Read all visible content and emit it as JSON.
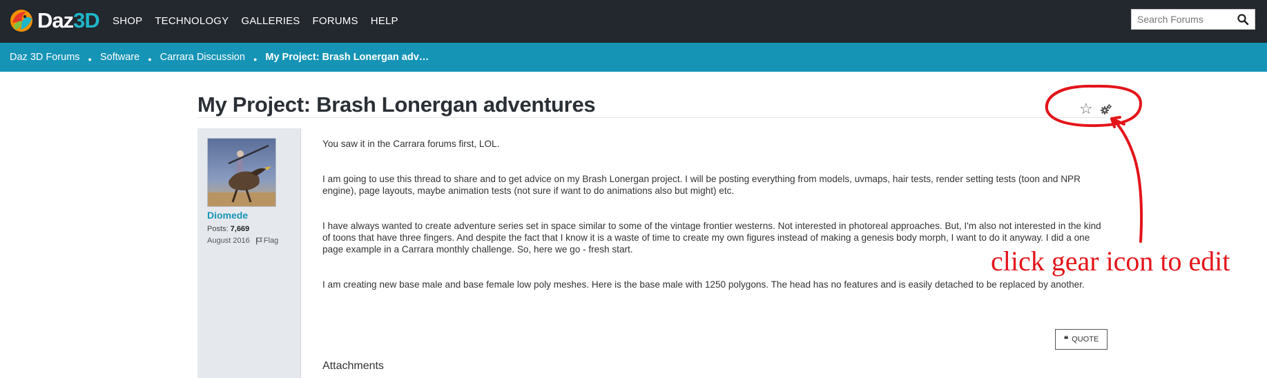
{
  "brand": {
    "name_part1": "Daz",
    "name_part2": "3D"
  },
  "nav": {
    "items": [
      {
        "label": "SHOP"
      },
      {
        "label": "TECHNOLOGY"
      },
      {
        "label": "GALLERIES"
      },
      {
        "label": "FORUMS"
      },
      {
        "label": "HELP"
      }
    ]
  },
  "search": {
    "placeholder": "Search Forums"
  },
  "breadcrumb": {
    "items": [
      {
        "label": "Daz 3D Forums"
      },
      {
        "label": "Software"
      },
      {
        "label": "Carrara Discussion"
      }
    ],
    "current": "My Project: Brash Lonergan adv…"
  },
  "thread": {
    "title": "My Project: Brash Lonergan adventures"
  },
  "author": {
    "name": "Diomede",
    "posts_label": "Posts:",
    "posts_count": "7,669",
    "joined": "August 2016",
    "flag_label": "Flag"
  },
  "post": {
    "paragraphs": [
      "You saw it in the Carrara forums first, LOL.",
      "I am going to use this thread to share and to get advice on my Brash Lonergan project.  I will be posting everything from models, uvmaps, hair tests, render setting tests (toon and NPR engine), page layouts, maybe animation tests (not sure if want to do animations also but might) etc.",
      "I have always wanted to create adventure series set in space similar to some of the vintage frontier westerns. Not interested in photoreal approaches.  But, I'm also not interested in the kind of toons that have three fingers.  And despite the fact that I know it is a waste of time to create my own figures instead of making a genesis body morph, I want to do it anyway.  I did a one page example in a Carrara monthly challenge.  So, here we go - fresh start.",
      "I am creating new base male and base female low poly meshes.  Here is the base male with 1250 polygons.  The head has no features and is easily detached to be replaced by another."
    ],
    "quote_label": "QUOTE",
    "attachments_label": "Attachments"
  },
  "annotation": {
    "text": "click gear icon to edit",
    "color": "#e3141a"
  },
  "colors": {
    "topbar": "#23272e",
    "breadcrumb_bar": "#1694b6",
    "author_name": "#1694b6",
    "author_panel": "#e5e9ee"
  },
  "icons": [
    "daz3d-logo-icon",
    "search-icon",
    "star-icon",
    "gear-icon",
    "flag-icon",
    "quote-icon"
  ]
}
